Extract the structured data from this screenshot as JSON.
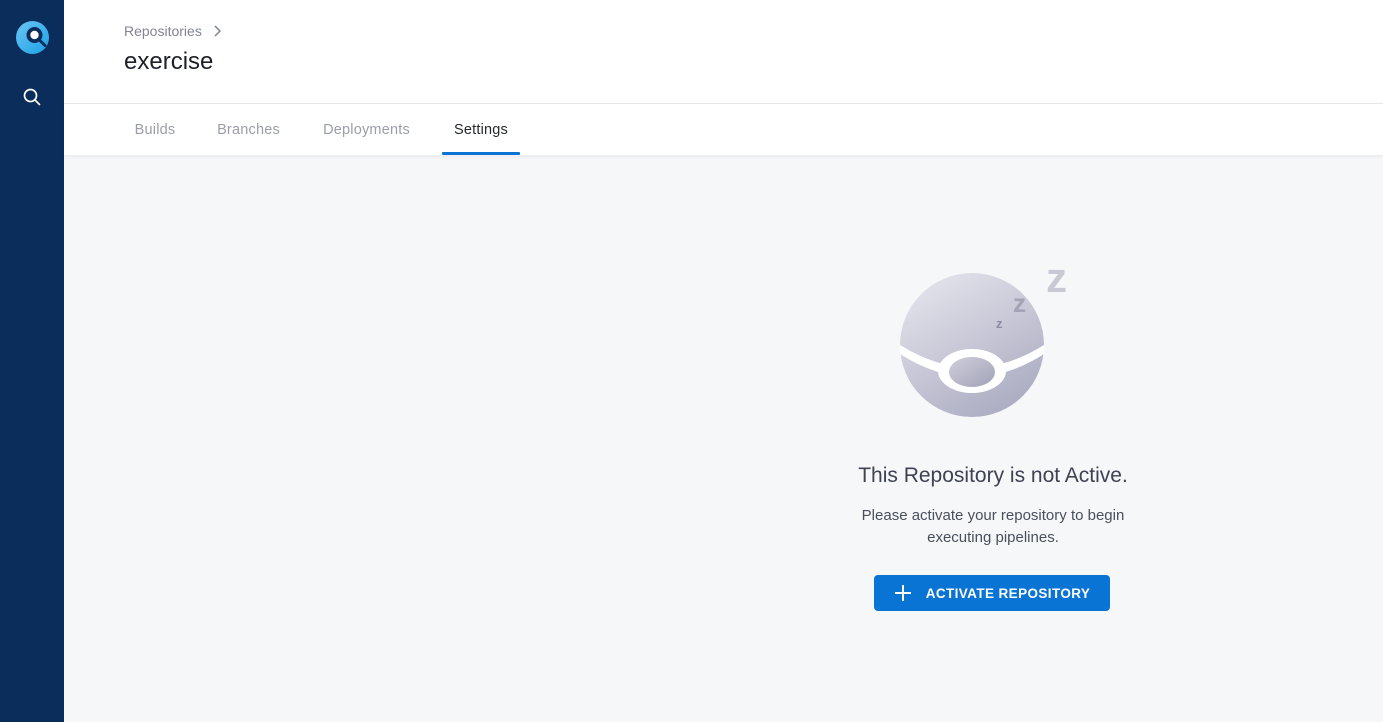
{
  "sidebar": {
    "logo_icon": "drone-logo-icon",
    "search_icon": "search-icon"
  },
  "header": {
    "breadcrumb": "Repositories",
    "breadcrumb_separator_icon": "chevron-right-icon",
    "title": "exercise"
  },
  "tabs": [
    {
      "label": "Builds",
      "active": false
    },
    {
      "label": "Branches",
      "active": false
    },
    {
      "label": "Deployments",
      "active": false
    },
    {
      "label": "Settings",
      "active": true
    }
  ],
  "empty_state": {
    "illustration_icon": "sleeping-drone-icon",
    "title": "This Repository is not Active.",
    "message": "Please activate your repository to begin executing pipelines.",
    "button_icon": "plus-icon",
    "button_label": "ACTIVATE REPOSITORY"
  },
  "colors": {
    "sidebar": "#0b2d5b",
    "accent": "#0a74d4",
    "background": "#f6f7f9"
  }
}
